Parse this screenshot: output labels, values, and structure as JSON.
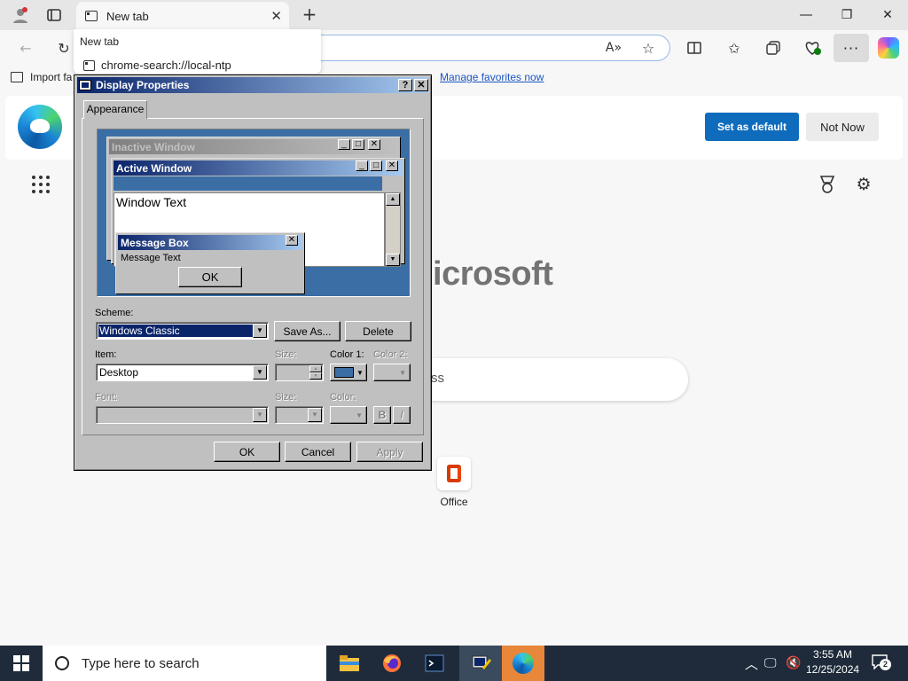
{
  "browser": {
    "tab_title": "New tab",
    "omnibox_dropdown": {
      "title": "New tab",
      "suggestion": "chrome-search://local-ntp"
    },
    "favorites_bar": {
      "import_label": "Import fa",
      "manage_link": "Manage favorites now"
    },
    "default_bar": {
      "set_default": "Set as default",
      "not_now": "Not Now"
    },
    "ntp": {
      "brand_text": "licrosoft",
      "search_fragment": "ss",
      "quick_link_label": "Office"
    }
  },
  "dialog": {
    "title": "Display Properties",
    "help_btn": "?",
    "close_btn": "✕",
    "tab_label": "Appearance",
    "preview": {
      "inactive_title": "Inactive Window",
      "active_title": "Active Window",
      "window_text": "Window Text",
      "msgbox_title": "Message Box",
      "msgbox_text": "Message Text",
      "msgbox_ok": "OK"
    },
    "scheme_label": "Scheme:",
    "scheme_value": "Windows Classic",
    "save_as": "Save As...",
    "delete": "Delete",
    "item_label": "Item:",
    "item_value": "Desktop",
    "size_label": "Size:",
    "color1_label": "Color 1:",
    "color2_label": "Color 2:",
    "font_label": "Font:",
    "font_size_label": "Size:",
    "font_color_label": "Color:",
    "bold_btn": "B",
    "italic_btn": "I",
    "ok": "OK",
    "cancel": "Cancel",
    "apply": "Apply",
    "color1_swatch": "#3a6ea5"
  },
  "taskbar": {
    "search_placeholder": "Type here to search",
    "time": "3:55 AM",
    "date": "12/25/2024",
    "notification_count": "2"
  }
}
